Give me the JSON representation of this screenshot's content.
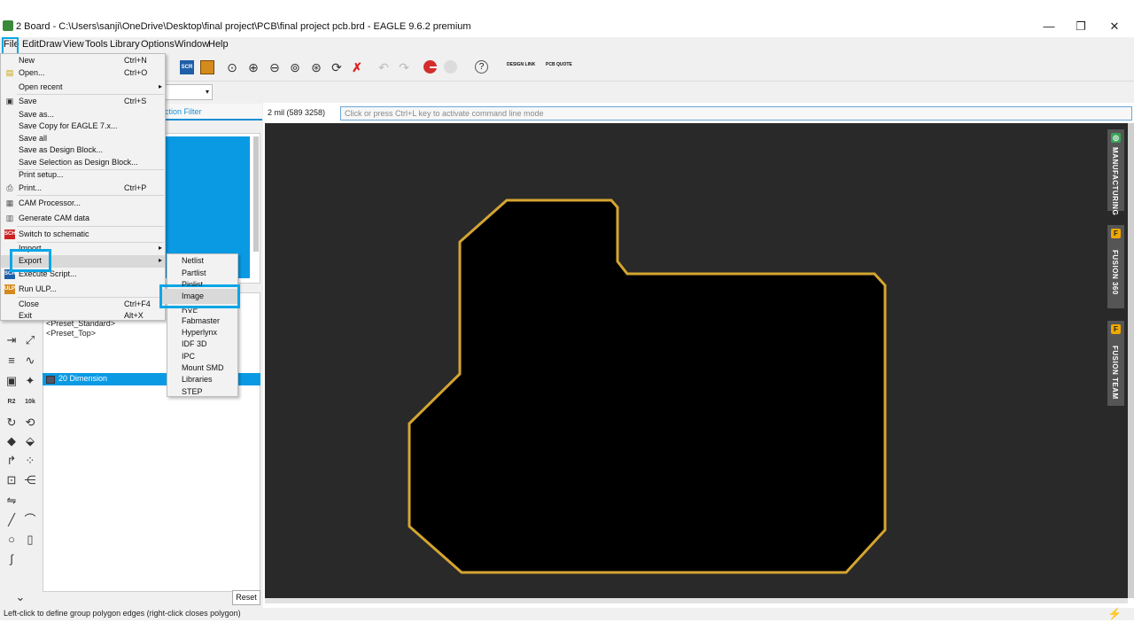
{
  "window": {
    "title": "2 Board - C:\\Users\\sanji\\OneDrive\\Desktop\\final project\\PCB\\final project pcb.brd - EAGLE 9.6.2 premium",
    "controls": [
      "—",
      "❐",
      "✕"
    ]
  },
  "menubar": [
    "File",
    "Edit",
    "Draw",
    "View",
    "Tools",
    "Library",
    "Options",
    "Window",
    "Help"
  ],
  "toolbar": {
    "scr_label": "SCR",
    "design_link": "DESIGN LINK",
    "pcb_quote": "PCB QUOTE"
  },
  "file_menu": [
    {
      "label": "New",
      "shortcut": "Ctrl+N",
      "icon": ""
    },
    {
      "label": "Open...",
      "shortcut": "Ctrl+O",
      "icon": "open-folder-icon"
    },
    {
      "label": "Open recent",
      "shortcut": "",
      "submenu": true
    },
    {
      "label": "Save",
      "shortcut": "Ctrl+S",
      "icon": "save-icon"
    },
    {
      "label": "Save as...",
      "shortcut": ""
    },
    {
      "label": "Save Copy for EAGLE 7.x...",
      "shortcut": ""
    },
    {
      "label": "Save all",
      "shortcut": ""
    },
    {
      "label": "Save as Design Block...",
      "shortcut": ""
    },
    {
      "label": "Save Selection as Design Block...",
      "shortcut": ""
    },
    {
      "label": "Print setup...",
      "shortcut": ""
    },
    {
      "label": "Print...",
      "shortcut": "Ctrl+P",
      "icon": "print-icon"
    },
    {
      "label": "CAM Processor...",
      "shortcut": "",
      "icon": "cam-icon"
    },
    {
      "label": "Generate CAM data",
      "shortcut": "",
      "icon": "cam-data-icon"
    },
    {
      "label": "Switch to schematic",
      "shortcut": "",
      "icon": "schematic-icon"
    },
    {
      "label": "Import",
      "shortcut": "",
      "submenu": true
    },
    {
      "label": "Export",
      "shortcut": "",
      "submenu": true
    },
    {
      "label": "Execute Script...",
      "shortcut": "",
      "icon": "script-icon"
    },
    {
      "label": "Run ULP...",
      "shortcut": "",
      "icon": "ulp-icon"
    },
    {
      "label": "Close",
      "shortcut": "Ctrl+F4"
    },
    {
      "label": "Exit",
      "shortcut": "Alt+X"
    }
  ],
  "export_submenu": [
    "Netlist",
    "Partlist",
    "Pinlist",
    "Image",
    "DXF",
    "Fabmaster",
    "Hyperlynx",
    "IDF 3D",
    "IPC",
    "Mount SMD",
    "Libraries",
    "STEP"
  ],
  "left_panel": {
    "selection_filter_tab": "ction Filter",
    "presets": [
      "<Preset_Standard>",
      "<Preset_Top>"
    ],
    "layer_row": "20 Dimension",
    "reset": "Reset"
  },
  "command": {
    "coordinates": "2 mil (589 3258)",
    "placeholder": "Click or press Ctrl+L key to activate command line mode"
  },
  "side_tabs": [
    "MANUFACTURING",
    "FUSION 360",
    "FUSION TEAM"
  ],
  "status": "Left-click to define group polygon edges (right-click closes polygon)",
  "colors": {
    "accent": "#0a9ae4",
    "board_outline": "#d4a531",
    "canvas": "#292929",
    "highlight": "#0aa6e6"
  }
}
